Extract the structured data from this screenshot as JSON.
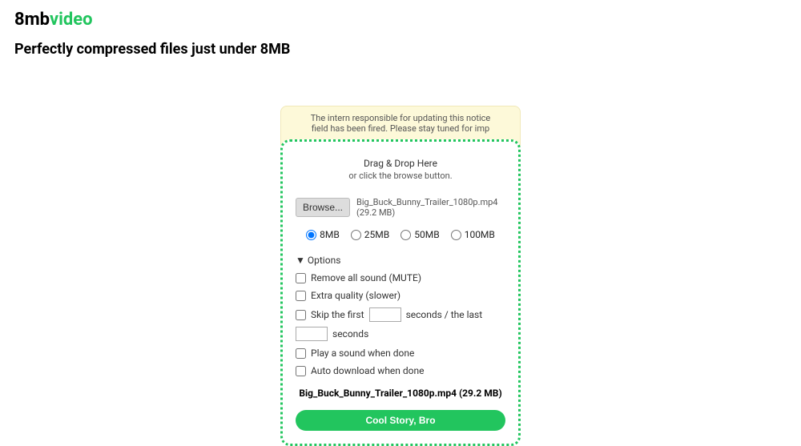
{
  "logo": {
    "part1": "8mb",
    "part2": "video"
  },
  "tagline": "Perfectly compressed files just under 8MB",
  "notice": "The intern responsible for updating this notice field has been fired. Please stay tuned for imp",
  "drop": {
    "line1": "Drag & Drop Here",
    "line2": "or click the browse button."
  },
  "browse_label": "Browse...",
  "selected_file": "Big_Buck_Bunny_Trailer_1080p.mp4 (29.2 MB)",
  "sizes": [
    "8MB",
    "25MB",
    "50MB",
    "100MB"
  ],
  "selected_size": "8MB",
  "options_label": "Options",
  "options": {
    "mute": "Remove all sound (MUTE)",
    "quality": "Extra quality (slower)",
    "skip_prefix": "Skip the first",
    "skip_mid": "seconds / the last",
    "skip_suffix": "seconds",
    "play_sound": "Play a sound when done",
    "auto_download": "Auto download when done"
  },
  "file_summary": "Big_Buck_Bunny_Trailer_1080p.mp4 (29.2 MB)",
  "submit_label": "Cool Story, Bro"
}
